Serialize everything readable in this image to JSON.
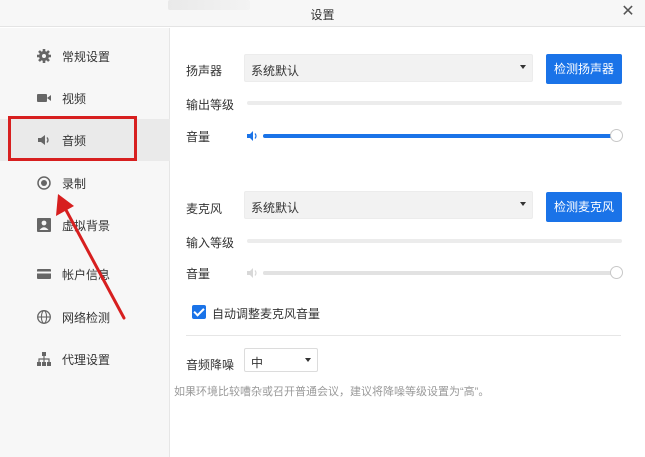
{
  "window": {
    "title": "设置"
  },
  "sidebar": {
    "items": [
      {
        "label": "常规设置"
      },
      {
        "label": "视频"
      },
      {
        "label": "音频"
      },
      {
        "label": "录制"
      },
      {
        "label": "虚拟背景"
      },
      {
        "label": "帐户信息"
      },
      {
        "label": "网络检测"
      },
      {
        "label": "代理设置"
      }
    ],
    "active": "音频"
  },
  "speaker": {
    "label": "扬声器",
    "device": "系统默认",
    "test_button": "检测扬声器",
    "output_level_label": "输出等级",
    "volume_label": "音量",
    "volume": 1.0
  },
  "microphone": {
    "label": "麦克风",
    "device": "系统默认",
    "test_button": "检测麦克风",
    "input_level_label": "输入等级",
    "volume_label": "音量",
    "volume": 1.0
  },
  "auto_adjust": {
    "label": "自动调整麦克风音量",
    "checked": true
  },
  "noise": {
    "label": "音频降噪",
    "value": "中",
    "hint": "如果环境比较嘈杂或召开普通会议，建议将降噪等级设置为“高”。"
  },
  "colors": {
    "accent": "#1a73e8",
    "annotation": "#d71f1f"
  }
}
